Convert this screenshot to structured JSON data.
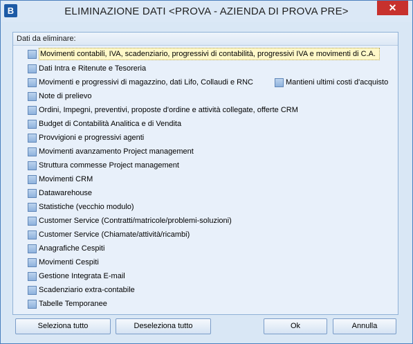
{
  "window": {
    "app_icon": "B",
    "title": "ELIMINAZIONE DATI <PROVA - AZIENDA DI PROVA PRE>",
    "close_glyph": "✕"
  },
  "group": {
    "header": "Dati da eliminare:",
    "options": [
      "Movimenti contabili, IVA, scadenziario, progressivi di contabilità, progressivi IVA e movimenti di C.A.",
      "Dati Intra e Ritenute e Tesoreria",
      "Movimenti  e progressivi di magazzino, dati Lifo, Collaudi e RNC",
      "Note di prelievo",
      "Ordini, Impegni, preventivi, proposte d'ordine e attività collegate, offerte CRM",
      "Budget di Contabilità Analitica e di Vendita",
      "Provvigioni e progressivi agenti",
      "Movimenti avanzamento Project management",
      "Struttura commesse Project management",
      "Movimenti CRM",
      "Datawarehouse",
      "Statistiche (vecchio modulo)",
      "Customer Service (Contratti/matricole/problemi-soluzioni)",
      "Customer Service (Chiamate/attività/ricambi)",
      "Anagrafiche Cespiti",
      "Movimenti Cespiti",
      "Gestione Integrata E-mail",
      "Scadenziario extra-contabile",
      "Tabelle Temporanee"
    ],
    "side_option": "Mantieni ultimi costi d'acquisto"
  },
  "buttons": {
    "select_all": "Seleziona tutto",
    "deselect_all": "Deseleziona tutto",
    "ok": "Ok",
    "cancel": "Annulla"
  }
}
